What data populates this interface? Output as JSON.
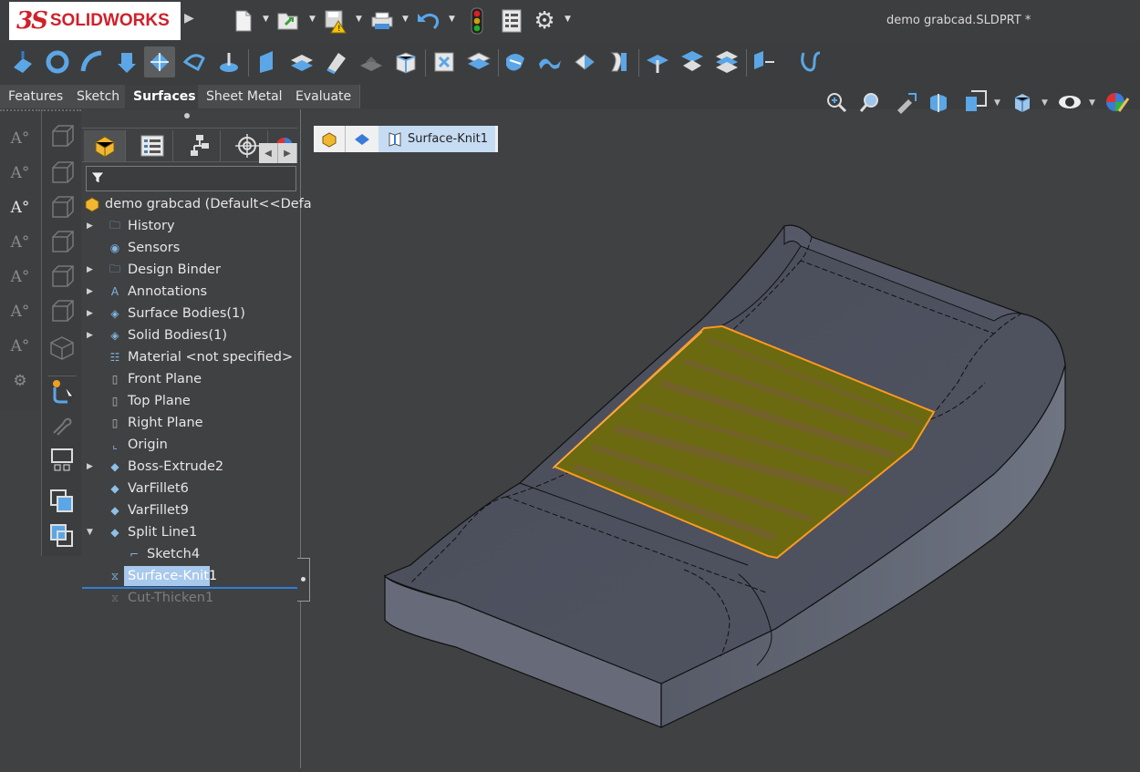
{
  "app": {
    "logo_ds": "3S",
    "logo_name": "SOLIDWORKS",
    "document_title": "demo grabcad.SLDPRT *"
  },
  "quick_access": [
    {
      "name": "new-document-icon",
      "glyph": "🗋"
    },
    {
      "name": "open-icon",
      "glyph": "📂"
    },
    {
      "name": "save-icon",
      "glyph": "💾"
    },
    {
      "name": "print-icon",
      "glyph": "🖶"
    },
    {
      "name": "undo-icon",
      "glyph": "↶"
    },
    {
      "name": "rebuild-icon",
      "glyph": "🚦"
    },
    {
      "name": "file-properties-icon",
      "glyph": "▤"
    },
    {
      "name": "options-icon",
      "glyph": "⚙"
    }
  ],
  "command_tabs": [
    "Features",
    "Sketch",
    "Surfaces",
    "Sheet Metal",
    "Evaluate"
  ],
  "active_tab": "Surfaces",
  "feature_tree": {
    "root": "demo grabcad  (Default<<Defa",
    "items": [
      {
        "label": "History",
        "expandable": true
      },
      {
        "label": "Sensors",
        "expandable": false
      },
      {
        "label": "Design Binder",
        "expandable": true
      },
      {
        "label": "Annotations",
        "expandable": true
      },
      {
        "label": "Surface Bodies(1)",
        "expandable": true
      },
      {
        "label": "Solid Bodies(1)",
        "expandable": true
      },
      {
        "label": "Material <not specified>",
        "expandable": false
      },
      {
        "label": "Front Plane",
        "expandable": false
      },
      {
        "label": "Top Plane",
        "expandable": false
      },
      {
        "label": "Right Plane",
        "expandable": false
      },
      {
        "label": "Origin",
        "expandable": false
      },
      {
        "label": "Boss-Extrude2",
        "expandable": true
      },
      {
        "label": "VarFillet6",
        "expandable": false
      },
      {
        "label": "VarFillet9",
        "expandable": false
      },
      {
        "label": "Split Line1",
        "expandable": true,
        "expanded": true
      },
      {
        "label": "Sketch4",
        "expandable": false,
        "child": true
      },
      {
        "label": "Surface-Knit1",
        "expandable": false,
        "selected": true
      },
      {
        "label": "Cut-Thicken1",
        "expandable": false,
        "suppressed": true
      }
    ]
  },
  "breadcrumb": {
    "current": "Surface-Knit1"
  },
  "colors": {
    "background": "#404142",
    "model_face": "#4b4e5a",
    "selection_fill": "#6b6a10",
    "selection_edge": "#ff9a1e",
    "accent_blue": "#2f7fd8"
  }
}
